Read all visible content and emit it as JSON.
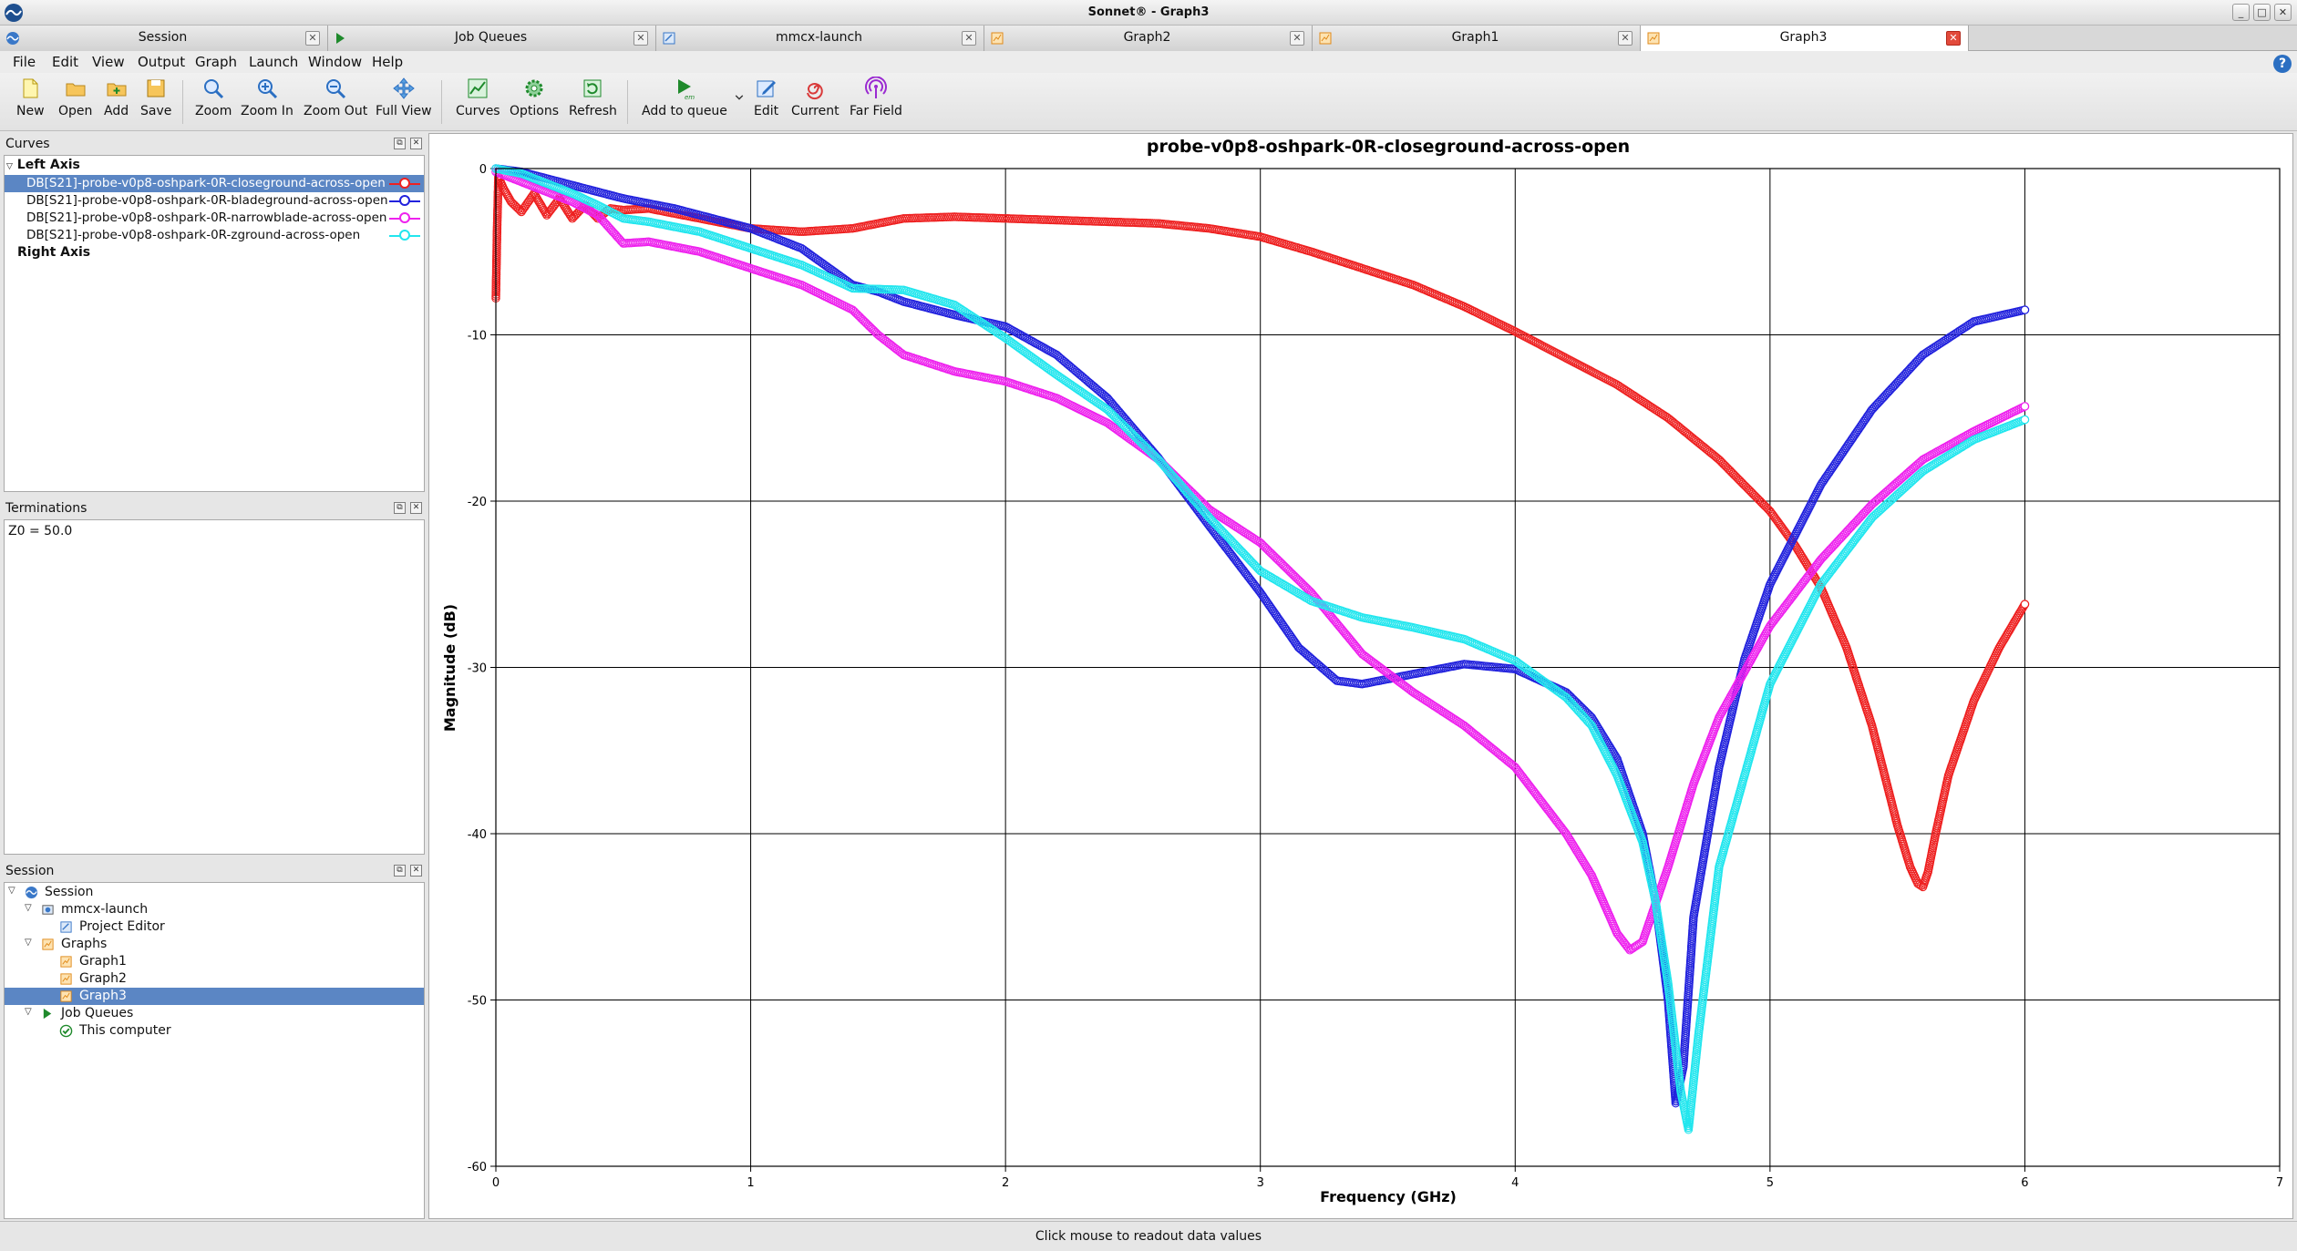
{
  "window": {
    "title": "Sonnet® - Graph3",
    "controls": [
      "_",
      "□",
      "✕"
    ]
  },
  "doc_tabs": [
    {
      "label": "Session",
      "icon": "session-icon"
    },
    {
      "label": "Job Queues",
      "icon": "em-queue-icon"
    },
    {
      "label": "mmcx-launch",
      "icon": "project-icon"
    },
    {
      "label": "Graph2",
      "icon": "graph-icon"
    },
    {
      "label": "Graph1",
      "icon": "graph-icon"
    },
    {
      "label": "Graph3",
      "icon": "graph-icon",
      "active": true
    }
  ],
  "menu": [
    "File",
    "Edit",
    "View",
    "Output",
    "Graph",
    "Launch",
    "Window",
    "Help"
  ],
  "toolbar": {
    "new": "New",
    "open": "Open",
    "add": "Add",
    "save": "Save",
    "zoom": "Zoom",
    "zoom_in": "Zoom In",
    "zoom_out": "Zoom Out",
    "full_view": "Full View",
    "curves": "Curves",
    "options": "Options",
    "refresh": "Refresh",
    "add_to_queue": "Add to queue",
    "edit": "Edit",
    "current": "Current",
    "far_field": "Far Field"
  },
  "curves_panel": {
    "title": "Curves",
    "left_axis": "Left Axis",
    "right_axis": "Right Axis",
    "items": [
      {
        "label": "DB[S21]-probe-v0p8-oshpark-0R-closeground-across-open",
        "color": "#ee2020"
      },
      {
        "label": "DB[S21]-probe-v0p8-oshpark-0R-bladeground-across-open",
        "color": "#2222dd"
      },
      {
        "label": "DB[S21]-probe-v0p8-oshpark-0R-narrowblade-across-open",
        "color": "#ee22ee"
      },
      {
        "label": "DB[S21]-probe-v0p8-oshpark-0R-zground-across-open",
        "color": "#22e6ee"
      }
    ]
  },
  "terminations_panel": {
    "title": "Terminations",
    "text": "Z0 = 50.0"
  },
  "session_panel": {
    "title": "Session",
    "tree": [
      {
        "label": "Session",
        "icon": "session-icon"
      },
      {
        "label": "mmcx-launch",
        "icon": "project-icon"
      },
      {
        "label": "Project Editor",
        "icon": "editor-icon"
      },
      {
        "label": "Graphs",
        "icon": "graph-folder-icon"
      },
      {
        "label": "Graph1",
        "icon": "graph-icon"
      },
      {
        "label": "Graph2",
        "icon": "graph-icon"
      },
      {
        "label": "Graph3",
        "icon": "graph-icon"
      },
      {
        "label": "Job Queues",
        "icon": "em-queue-icon"
      },
      {
        "label": "This computer",
        "icon": "check-icon"
      }
    ]
  },
  "status": {
    "text": "Click mouse to readout data values"
  },
  "chart_data": {
    "type": "scatter",
    "title": "probe-v0p8-oshpark-0R-closeground-across-open",
    "xlabel": "Frequency (GHz)",
    "ylabel": "Magnitude (dB)",
    "xlim": [
      0,
      7
    ],
    "ylim": [
      -60,
      0
    ],
    "xticks": [
      0,
      1,
      2,
      3,
      4,
      5,
      6,
      7
    ],
    "yticks": [
      0,
      -10,
      -20,
      -30,
      -40,
      -50,
      -60
    ],
    "grid": true,
    "legend": "none",
    "series": [
      {
        "name": "DB[S21]-probe-v0p8-oshpark-0R-closeground-across-open",
        "color": "#ee2020",
        "x": [
          0.0,
          0.005,
          0.01,
          0.03,
          0.06,
          0.1,
          0.15,
          0.2,
          0.25,
          0.3,
          0.35,
          0.4,
          0.45,
          0.5,
          0.6,
          0.8,
          1.0,
          1.2,
          1.4,
          1.6,
          1.8,
          2.0,
          2.2,
          2.4,
          2.6,
          2.8,
          3.0,
          3.2,
          3.4,
          3.6,
          3.8,
          4.0,
          4.2,
          4.4,
          4.6,
          4.8,
          5.0,
          5.1,
          5.2,
          5.3,
          5.4,
          5.45,
          5.5,
          5.55,
          5.58,
          5.6,
          5.62,
          5.65,
          5.7,
          5.8,
          5.9,
          6.0
        ],
        "y": [
          -7.8,
          -3.5,
          -0.5,
          -1.2,
          -2.0,
          -2.6,
          -1.5,
          -2.8,
          -1.8,
          -3.0,
          -2.2,
          -3.0,
          -2.4,
          -2.5,
          -2.4,
          -3.0,
          -3.6,
          -3.8,
          -3.6,
          -3.0,
          -2.9,
          -3.0,
          -3.1,
          -3.2,
          -3.3,
          -3.6,
          -4.1,
          -5.0,
          -6.0,
          -7.0,
          -8.3,
          -9.8,
          -11.4,
          -13.0,
          -15.0,
          -17.5,
          -20.6,
          -22.7,
          -25.2,
          -28.8,
          -33.5,
          -36.5,
          -39.5,
          -42.0,
          -43.0,
          -43.2,
          -42.3,
          -40.0,
          -36.5,
          -32.0,
          -28.8,
          -26.2
        ]
      },
      {
        "name": "DB[S21]-probe-v0p8-oshpark-0R-bladeground-across-open",
        "color": "#2222dd",
        "x": [
          0.0,
          0.1,
          0.2,
          0.3,
          0.4,
          0.5,
          0.6,
          0.7,
          0.8,
          0.9,
          1.0,
          1.2,
          1.4,
          1.5,
          1.6,
          1.8,
          2.0,
          2.2,
          2.4,
          2.6,
          2.8,
          3.0,
          3.15,
          3.3,
          3.4,
          3.6,
          3.8,
          4.0,
          4.2,
          4.3,
          4.4,
          4.5,
          4.55,
          4.6,
          4.63,
          4.66,
          4.7,
          4.8,
          4.9,
          5.0,
          5.2,
          5.4,
          5.6,
          5.8,
          6.0
        ],
        "y": [
          0.0,
          -0.2,
          -0.6,
          -1.0,
          -1.4,
          -1.8,
          -2.1,
          -2.4,
          -2.8,
          -3.2,
          -3.6,
          -4.8,
          -7.0,
          -7.4,
          -8.0,
          -8.8,
          -9.5,
          -11.2,
          -13.8,
          -17.4,
          -21.5,
          -25.5,
          -28.8,
          -30.8,
          -31.0,
          -30.4,
          -29.8,
          -30.1,
          -31.5,
          -33.0,
          -35.5,
          -40.0,
          -44.0,
          -50.0,
          -56.2,
          -54.0,
          -45.0,
          -36.0,
          -29.5,
          -25.0,
          -19.0,
          -14.5,
          -11.2,
          -9.2,
          -8.5
        ]
      },
      {
        "name": "DB[S21]-probe-v0p8-oshpark-0R-narrowblade-across-open",
        "color": "#ee22ee",
        "x": [
          0.0,
          0.1,
          0.2,
          0.3,
          0.4,
          0.5,
          0.6,
          0.8,
          1.0,
          1.2,
          1.4,
          1.5,
          1.6,
          1.8,
          2.0,
          2.2,
          2.4,
          2.6,
          2.8,
          3.0,
          3.2,
          3.4,
          3.6,
          3.8,
          4.0,
          4.2,
          4.3,
          4.4,
          4.45,
          4.5,
          4.6,
          4.7,
          4.8,
          5.0,
          5.2,
          5.4,
          5.6,
          5.8,
          6.0
        ],
        "y": [
          -0.2,
          -0.8,
          -1.4,
          -2.0,
          -2.8,
          -4.5,
          -4.4,
          -5.0,
          -6.0,
          -7.0,
          -8.5,
          -10.0,
          -11.2,
          -12.2,
          -12.8,
          -13.8,
          -15.3,
          -17.5,
          -20.5,
          -22.5,
          -25.5,
          -29.2,
          -31.5,
          -33.5,
          -36.0,
          -40.0,
          -42.5,
          -46.0,
          -47.0,
          -46.5,
          -42.0,
          -37.0,
          -33.0,
          -27.5,
          -23.5,
          -20.2,
          -17.5,
          -15.8,
          -14.3
        ]
      },
      {
        "name": "DB[S21]-probe-v0p8-oshpark-0R-zground-across-open",
        "color": "#22e6ee",
        "x": [
          0.0,
          0.1,
          0.2,
          0.3,
          0.4,
          0.5,
          0.6,
          0.8,
          1.0,
          1.2,
          1.4,
          1.6,
          1.8,
          2.0,
          2.2,
          2.4,
          2.6,
          2.8,
          3.0,
          3.2,
          3.4,
          3.6,
          3.8,
          4.0,
          4.2,
          4.3,
          4.4,
          4.5,
          4.55,
          4.6,
          4.65,
          4.68,
          4.72,
          4.8,
          5.0,
          5.2,
          5.4,
          5.6,
          5.8,
          6.0
        ],
        "y": [
          0.0,
          -0.3,
          -0.9,
          -1.5,
          -2.2,
          -3.0,
          -3.2,
          -3.8,
          -4.8,
          -5.8,
          -7.2,
          -7.3,
          -8.2,
          -10.2,
          -12.4,
          -14.5,
          -17.5,
          -21.0,
          -24.2,
          -26.0,
          -27.0,
          -27.6,
          -28.3,
          -29.6,
          -31.8,
          -33.5,
          -36.5,
          -40.5,
          -44.0,
          -49.0,
          -55.5,
          -57.8,
          -52.0,
          -42.0,
          -31.0,
          -25.0,
          -21.0,
          -18.2,
          -16.3,
          -15.1
        ]
      }
    ]
  }
}
